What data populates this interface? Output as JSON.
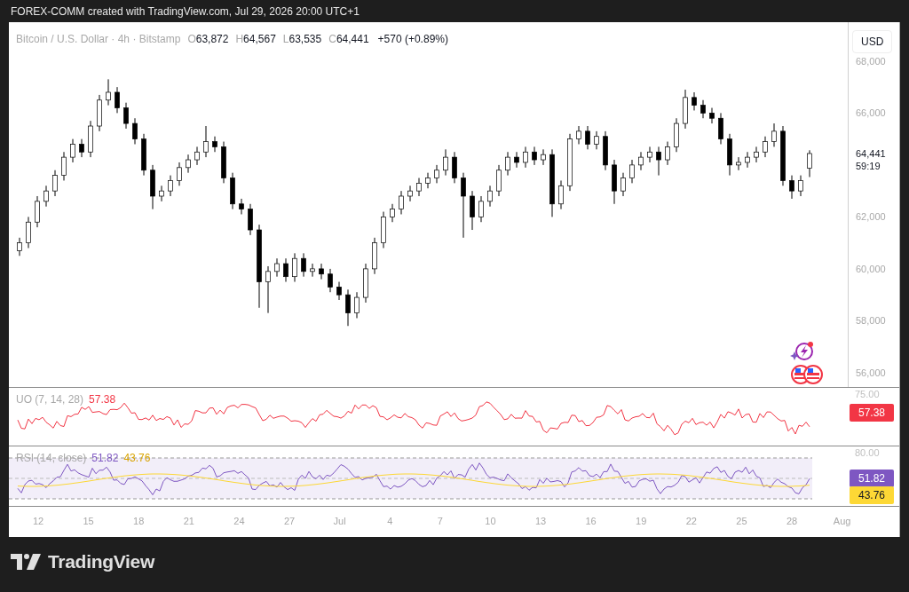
{
  "header": {
    "text": "FOREX-COMM created with TradingView.com, Jul 29, 2026 20:00 UTC+1"
  },
  "legend": {
    "symbol": "Bitcoin / U.S. Dollar · 4h · Bitstamp",
    "ohlc": [
      {
        "label": "O",
        "value": "63,872"
      },
      {
        "label": "H",
        "value": "64,567"
      },
      {
        "label": "L",
        "value": "63,535"
      },
      {
        "label": "C",
        "value": "64,441"
      }
    ],
    "change": "+570 (+0.89%)"
  },
  "chart_data": {
    "type": "candlestick",
    "ylim": [
      55450,
      69500
    ],
    "yticks": [
      {
        "value": 68000,
        "label": "68,000"
      },
      {
        "value": 66000,
        "label": "66,000"
      },
      {
        "value": 62000,
        "label": "62,000"
      },
      {
        "value": 60000,
        "label": "60,000"
      },
      {
        "value": 58000,
        "label": "58,000"
      },
      {
        "value": 56000,
        "label": "56,000"
      }
    ],
    "categories": [
      null,
      null,
      null,
      null,
      null,
      null,
      null,
      null,
      null,
      null,
      null,
      null,
      null,
      null,
      null,
      null,
      null,
      null,
      null,
      null,
      null,
      null,
      null,
      null,
      null,
      null,
      null,
      null,
      null,
      null,
      null,
      null,
      null,
      null,
      null,
      null,
      null,
      null,
      null,
      null,
      null,
      null,
      null,
      null,
      null,
      null,
      null,
      null,
      null,
      null,
      null,
      null,
      null,
      null,
      null,
      null,
      null,
      null,
      null,
      null,
      null,
      null,
      null,
      null,
      null,
      null,
      null,
      null,
      null,
      null,
      null,
      null,
      null,
      null,
      null,
      null,
      null,
      null,
      null,
      null,
      null,
      null,
      null,
      null,
      null,
      null,
      null,
      null,
      null,
      null
    ],
    "ohlc": [
      [
        60700,
        61200,
        60500,
        61000
      ],
      [
        61000,
        62000,
        60800,
        61800
      ],
      [
        61800,
        62800,
        61600,
        62600
      ],
      [
        62600,
        63200,
        62400,
        63000
      ],
      [
        63000,
        63800,
        62800,
        63600
      ],
      [
        63600,
        64500,
        63400,
        64300
      ],
      [
        64300,
        65000,
        64100,
        64800
      ],
      [
        64800,
        65000,
        64300,
        64500
      ],
      [
        64500,
        65700,
        64300,
        65500
      ],
      [
        65500,
        66700,
        65300,
        66500
      ],
      [
        66500,
        67300,
        66300,
        66800
      ],
      [
        66800,
        67000,
        66000,
        66200
      ],
      [
        66200,
        66400,
        65400,
        65600
      ],
      [
        65600,
        65800,
        64800,
        65000
      ],
      [
        65000,
        65200,
        63600,
        63800
      ],
      [
        63800,
        64000,
        62300,
        62800
      ],
      [
        62800,
        63200,
        62600,
        63000
      ],
      [
        63000,
        63600,
        62800,
        63400
      ],
      [
        63400,
        64100,
        63200,
        63900
      ],
      [
        63900,
        64400,
        63700,
        64200
      ],
      [
        64200,
        64700,
        64000,
        64500
      ],
      [
        64500,
        65500,
        64300,
        64900
      ],
      [
        64900,
        65100,
        64500,
        64700
      ],
      [
        64700,
        64900,
        63300,
        63500
      ],
      [
        63500,
        63700,
        62300,
        62500
      ],
      [
        62500,
        62700,
        62100,
        62300
      ],
      [
        62300,
        62500,
        61300,
        61500
      ],
      [
        61500,
        61700,
        58500,
        59500
      ],
      [
        59500,
        60100,
        58300,
        59900
      ],
      [
        59900,
        60400,
        59700,
        60200
      ],
      [
        60200,
        60400,
        59500,
        59700
      ],
      [
        59700,
        60600,
        59500,
        60400
      ],
      [
        60400,
        60600,
        59700,
        59900
      ],
      [
        59900,
        60200,
        59700,
        60000
      ],
      [
        60000,
        60200,
        59600,
        59800
      ],
      [
        59800,
        60000,
        59100,
        59300
      ],
      [
        59300,
        59500,
        58800,
        59000
      ],
      [
        59000,
        59200,
        57800,
        58300
      ],
      [
        58300,
        59100,
        58100,
        58900
      ],
      [
        58900,
        60200,
        58700,
        60000
      ],
      [
        60000,
        61200,
        59800,
        61000
      ],
      [
        61000,
        62200,
        60800,
        62000
      ],
      [
        62000,
        62500,
        61800,
        62300
      ],
      [
        62300,
        63000,
        62100,
        62800
      ],
      [
        62800,
        63200,
        62600,
        63000
      ],
      [
        63000,
        63500,
        62800,
        63300
      ],
      [
        63300,
        63700,
        63100,
        63500
      ],
      [
        63500,
        64000,
        63300,
        63800
      ],
      [
        63800,
        64600,
        63600,
        64300
      ],
      [
        64300,
        64500,
        63300,
        63500
      ],
      [
        63500,
        63700,
        61200,
        62800
      ],
      [
        62800,
        63000,
        61500,
        62000
      ],
      [
        62000,
        62800,
        61800,
        62600
      ],
      [
        62600,
        63200,
        62400,
        63000
      ],
      [
        63000,
        64000,
        62800,
        63800
      ],
      [
        63800,
        64500,
        63600,
        64300
      ],
      [
        64300,
        64500,
        63900,
        64100
      ],
      [
        64100,
        64700,
        63900,
        64500
      ],
      [
        64500,
        64700,
        64000,
        64200
      ],
      [
        64200,
        64600,
        64000,
        64400
      ],
      [
        64400,
        64600,
        62000,
        62500
      ],
      [
        62500,
        63400,
        62300,
        63200
      ],
      [
        63200,
        65200,
        63000,
        65000
      ],
      [
        65000,
        65500,
        64800,
        65300
      ],
      [
        65300,
        65500,
        64600,
        64800
      ],
      [
        64800,
        65300,
        64600,
        65100
      ],
      [
        65100,
        65300,
        63800,
        64000
      ],
      [
        64000,
        64200,
        62500,
        63000
      ],
      [
        63000,
        63700,
        62800,
        63500
      ],
      [
        63500,
        64200,
        63300,
        64000
      ],
      [
        64000,
        64500,
        63800,
        64300
      ],
      [
        64300,
        64700,
        64100,
        64500
      ],
      [
        64500,
        64700,
        63600,
        64200
      ],
      [
        64200,
        64900,
        64000,
        64700
      ],
      [
        64700,
        65800,
        64500,
        65600
      ],
      [
        65600,
        66900,
        65400,
        66600
      ],
      [
        66600,
        66800,
        66100,
        66300
      ],
      [
        66300,
        66500,
        65800,
        66000
      ],
      [
        66000,
        66200,
        65600,
        65800
      ],
      [
        65800,
        66000,
        64800,
        65000
      ],
      [
        65000,
        65200,
        63600,
        64000
      ],
      [
        64000,
        64300,
        63800,
        64100
      ],
      [
        64100,
        64500,
        63900,
        64300
      ],
      [
        64300,
        64700,
        64100,
        64500
      ],
      [
        64500,
        65100,
        64300,
        64900
      ],
      [
        64900,
        65600,
        64700,
        65300
      ],
      [
        65300,
        65500,
        63200,
        63400
      ],
      [
        63400,
        63600,
        62700,
        63000
      ],
      [
        63000,
        63600,
        62800,
        63400
      ],
      [
        63872,
        64567,
        63535,
        64441
      ]
    ]
  },
  "currency_button": "USD",
  "last_price": {
    "price": "64,441",
    "countdown": "59:19"
  },
  "indicators": [
    {
      "kind": "uo",
      "label": "UO (7, 14, 28)",
      "axis_label": "75.00",
      "values": [
        {
          "text": "57.38",
          "color": "#f23645"
        }
      ],
      "badges": [
        {
          "text": "57.38",
          "color": "#f23645"
        }
      ]
    },
    {
      "kind": "rsi",
      "label": "RSI (14, close)",
      "axis_label": "80.00",
      "values": [
        {
          "text": "51.82",
          "color": "#7e57c2"
        },
        {
          "text": "43.76",
          "color": "#d9a400"
        }
      ],
      "badges": [
        {
          "text": "51.82",
          "color": "#7e57c2"
        },
        {
          "text": "43.76",
          "color": "#fdd835"
        }
      ]
    }
  ],
  "time_axis": [
    "12",
    "15",
    "18",
    "21",
    "24",
    "27",
    "Jul",
    "4",
    "7",
    "10",
    "13",
    "16",
    "19",
    "22",
    "25",
    "28",
    "Aug"
  ],
  "footer": {
    "brand": "TradingView"
  }
}
